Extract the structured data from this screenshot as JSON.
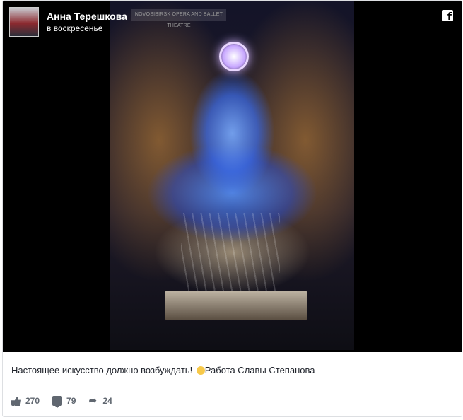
{
  "post": {
    "author": "Анна Терешкова",
    "time": "в воскресенье",
    "caption": "Настоящее искусство должно возбуждать! ",
    "caption_tail": "Работа Славы Степанова",
    "image_sign_text": "NOVOSIBIRSK OPERA AND BALLET THEATRE"
  },
  "stats": {
    "likes": "270",
    "comments": "79",
    "shares": "24"
  },
  "icons": {
    "brand": "facebook-icon",
    "like": "thumbs-up-icon",
    "comment": "comment-icon",
    "share": "share-arrow-icon",
    "emoji": "winking-smiley-icon"
  }
}
